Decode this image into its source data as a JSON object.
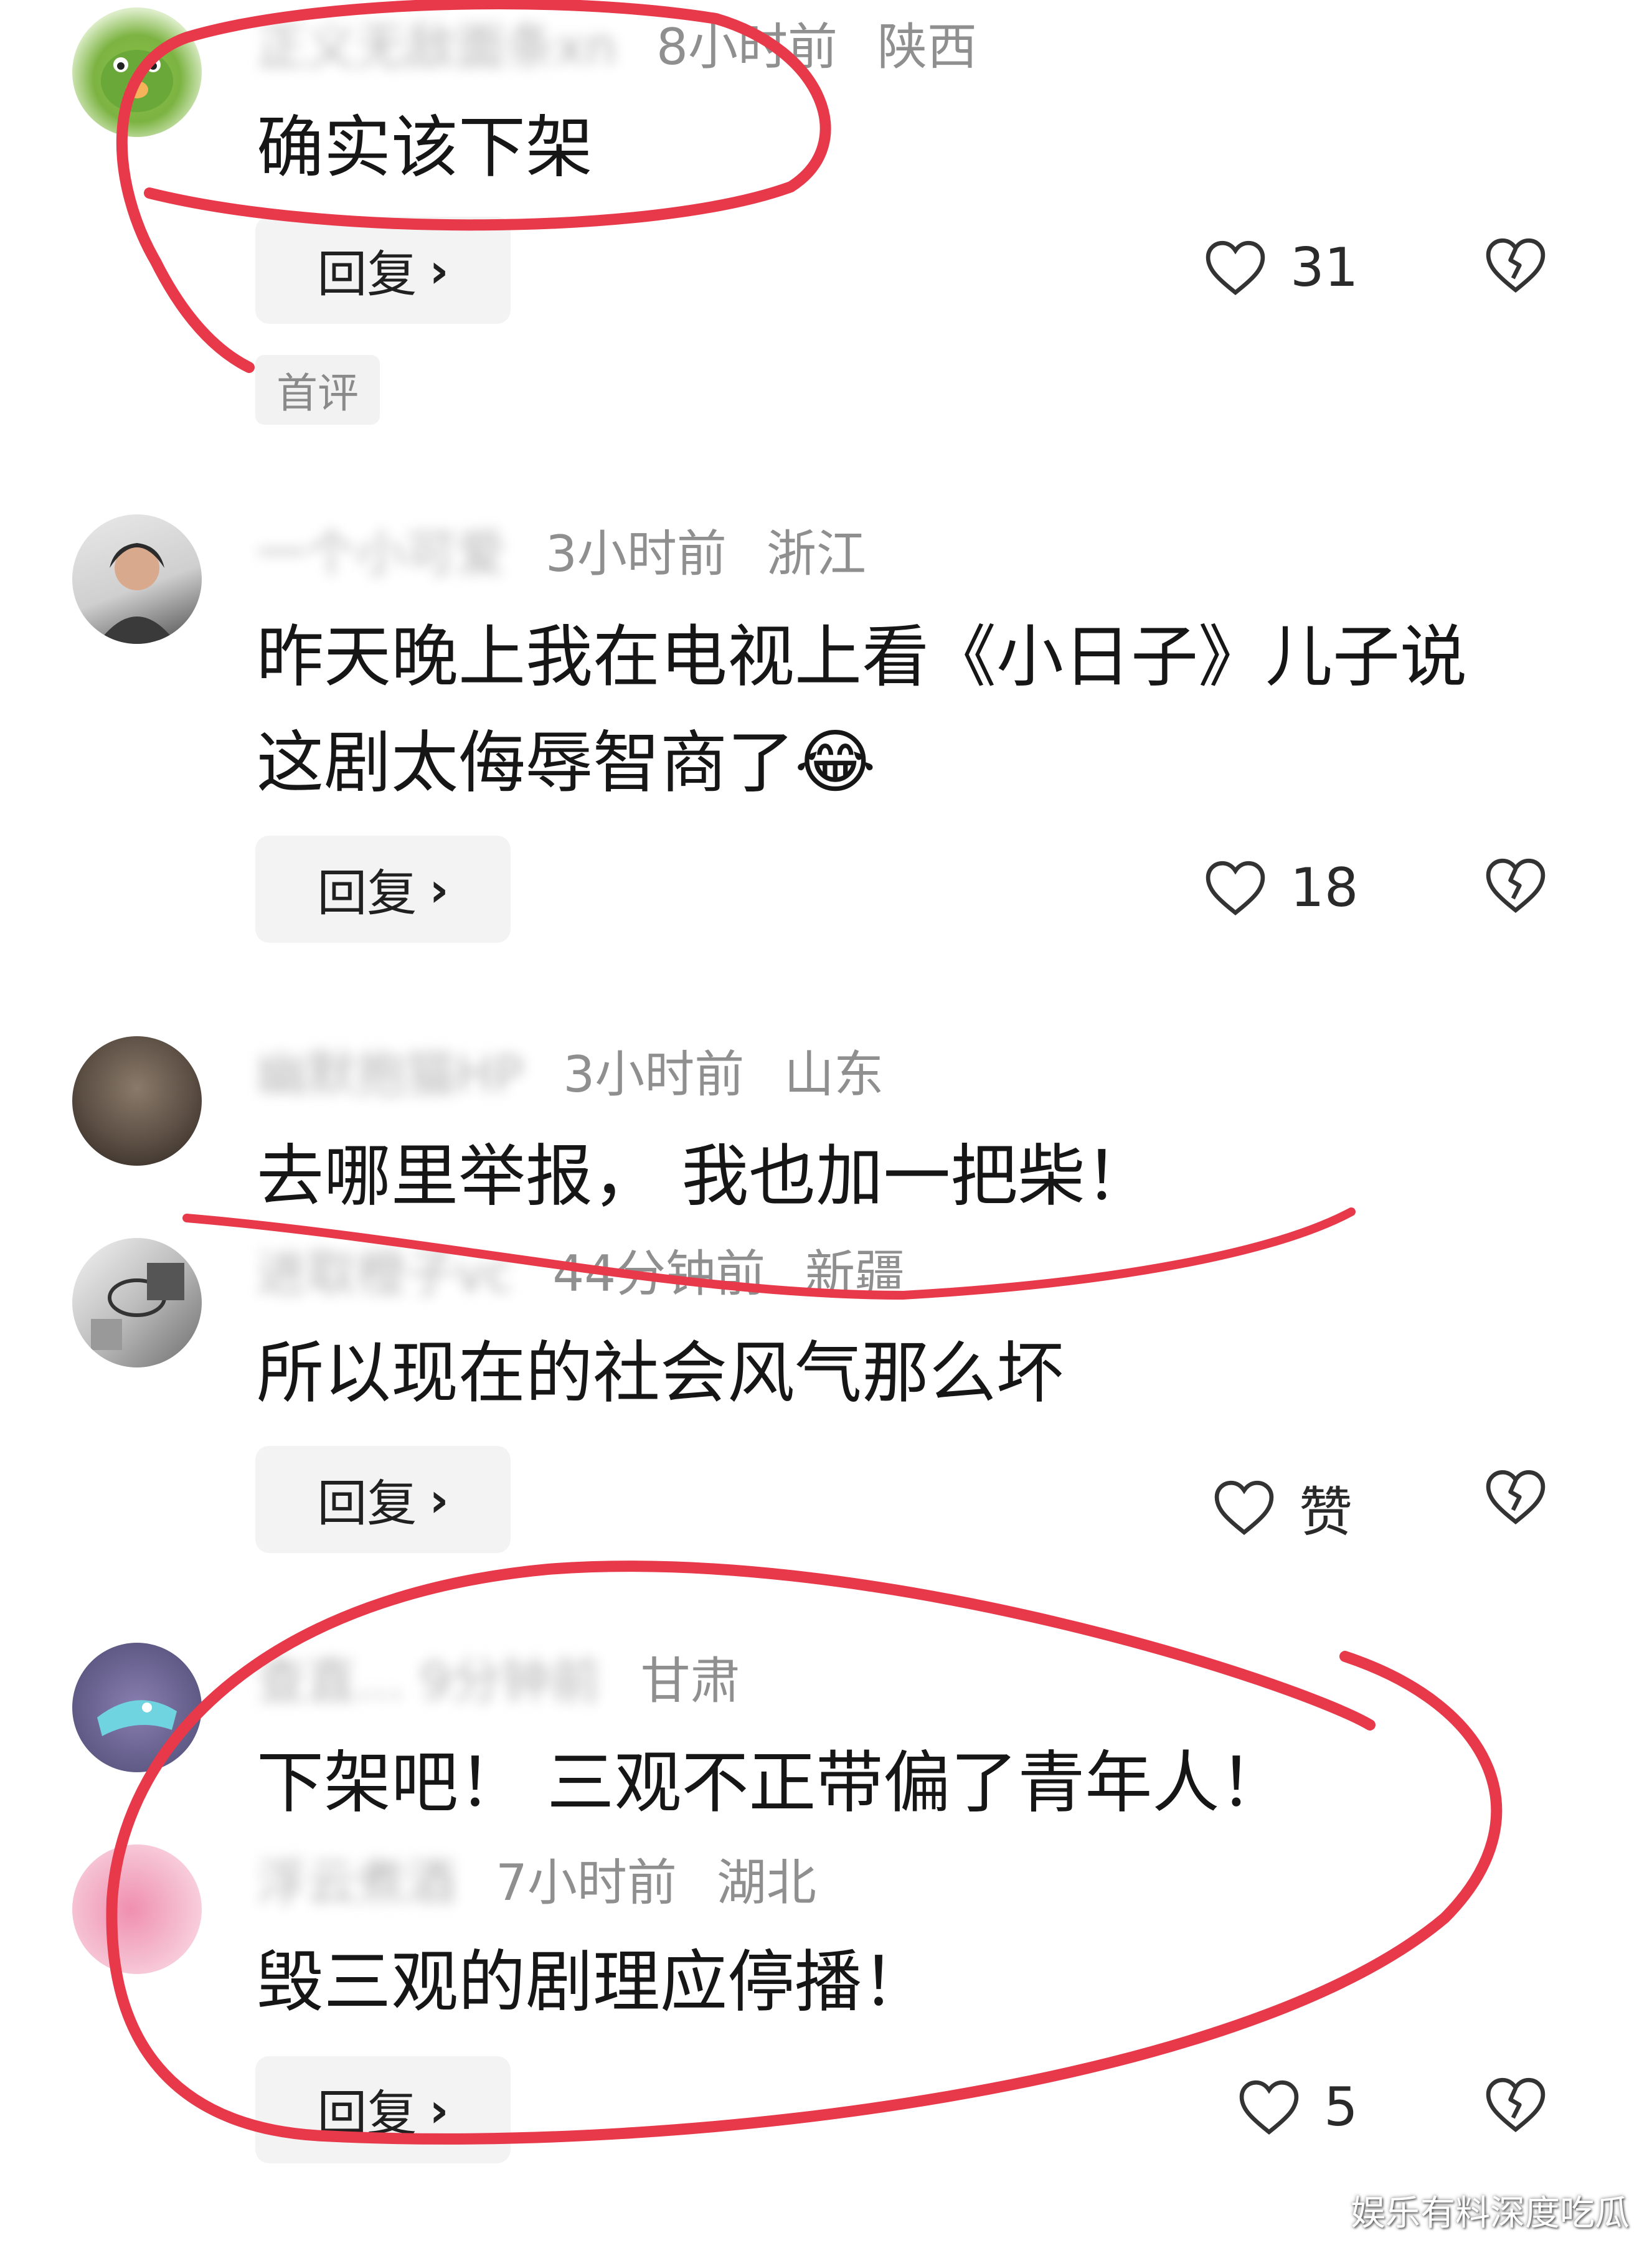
{
  "comments": [
    {
      "username": "正义无敌面条xn",
      "time": "8小时前",
      "region": "陕西",
      "content_lines": [
        "确实该下架"
      ],
      "reply_label": "回复",
      "like_count": "31",
      "tag": "首评"
    },
    {
      "username": "一个小可爱",
      "time": "3小时前",
      "region": "浙江",
      "content_lines": [
        "昨天晚上我在电视上看《小日子》儿子说",
        "这剧太侮辱智商了"
      ],
      "emoji": "😂",
      "reply_label": "回复",
      "like_count": "18"
    },
    {
      "username": "幽默抱猫HP",
      "time": "3小时前",
      "region": "山东",
      "content_lines": [
        "去哪里举报， 我也加一把柴！"
      ]
    },
    {
      "username": "进取橙子vc",
      "time": "44分钟前",
      "region": "新疆",
      "content_lines": [
        "所以现在的社会风气那么坏"
      ],
      "reply_label": "回复",
      "like_count": "赞"
    },
    {
      "username": "查直... 9分钟前",
      "region": "甘肃",
      "content_lines": [
        "下架吧！ 三观不正带偏了青年人！"
      ]
    },
    {
      "username": "浮云煮酒",
      "time": "7小时前",
      "region": "湖北",
      "content_lines": [
        "毁三观的剧理应停播！"
      ],
      "reply_label": "回复",
      "like_count": "5"
    }
  ],
  "watermark": "娱乐有料深度吃瓜",
  "colors": {
    "annotation_red": "#e8394a",
    "meta_gray": "#8f8f8f",
    "button_bg": "#f3f3f3"
  },
  "icons": {
    "like": "heart-outline-icon",
    "dislike": "broken-heart-icon",
    "chevron": "chevron-right-icon"
  }
}
